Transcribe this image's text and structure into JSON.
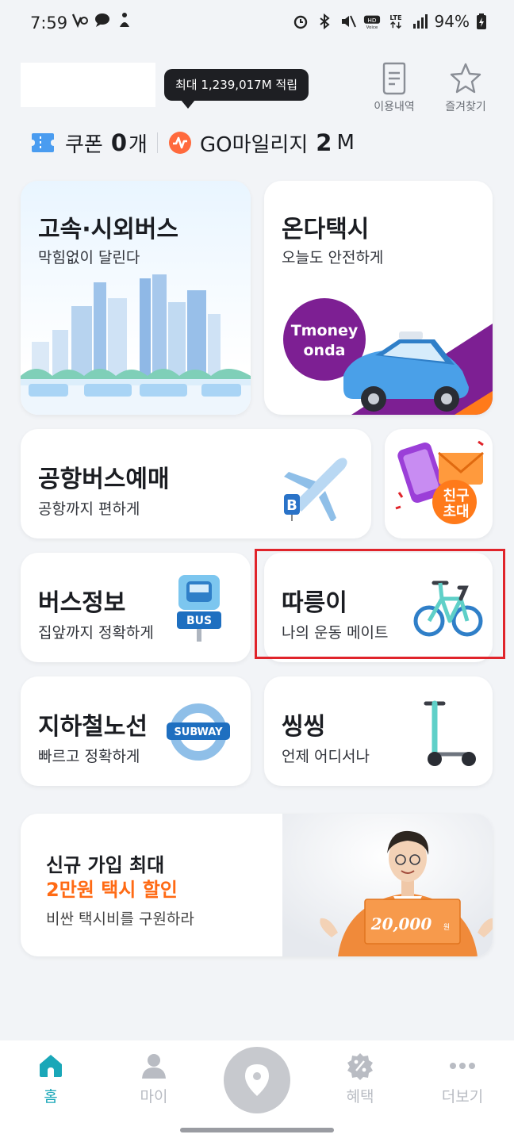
{
  "status_bar": {
    "time": "7:59",
    "battery": "94%",
    "icons": [
      "volte-icon",
      "message-icon",
      "chat-icon",
      "figure-icon",
      "alarm-icon",
      "bluetooth-icon",
      "mute-icon",
      "hd-voice-icon",
      "lte-icon",
      "signal-icon",
      "battery-icon"
    ]
  },
  "header": {
    "tooltip": "최대 1,239,017M 적립",
    "history_label": "이용내역",
    "favorites_label": "즐겨찾기"
  },
  "counts": {
    "coupon_label": "쿠폰",
    "coupon_count": "0",
    "coupon_unit": "개",
    "mileage_label": "GO마일리지",
    "mileage_value": "2",
    "mileage_unit": "M"
  },
  "cards": {
    "express": {
      "title": "고속·시외버스",
      "subtitle": "막힘없이 달린다"
    },
    "taxi": {
      "title": "온다택시",
      "subtitle": "오늘도 안전하게",
      "badge": "Tmoney\nonda"
    },
    "airport": {
      "title": "공항버스예매",
      "subtitle": "공항까지 편하게"
    },
    "invite": {
      "badge": "친구\n초대"
    },
    "businfo": {
      "title": "버스정보",
      "subtitle": "집앞까지 정확하게",
      "sign": "BUS"
    },
    "bike": {
      "title": "따릉이",
      "subtitle": "나의 운동 메이트"
    },
    "subway": {
      "title": "지하철노선",
      "subtitle": "빠르고 정확하게",
      "sign": "SUBWAY"
    },
    "scooter": {
      "title": "씽씽",
      "subtitle": "언제 어디서나"
    }
  },
  "promo": {
    "line1": "신규 가입 최대",
    "line2": "2만원 택시 할인",
    "line3": "비싼 택시비를 구원하라",
    "voucher": "20,000"
  },
  "bottom_nav": {
    "items": [
      {
        "label": "홈",
        "icon": "home-icon",
        "active": true
      },
      {
        "label": "마이",
        "icon": "person-icon",
        "active": false
      },
      {
        "label": "",
        "icon": "location-pin-icon",
        "active": false
      },
      {
        "label": "혜택",
        "icon": "percent-badge-icon",
        "active": false
      },
      {
        "label": "더보기",
        "icon": "more-dots-icon",
        "active": false
      }
    ]
  },
  "colors": {
    "accent": "#1aa7b8",
    "orange": "#ff6a14",
    "purple": "#7d1f93",
    "highlight": "#e0242b"
  }
}
